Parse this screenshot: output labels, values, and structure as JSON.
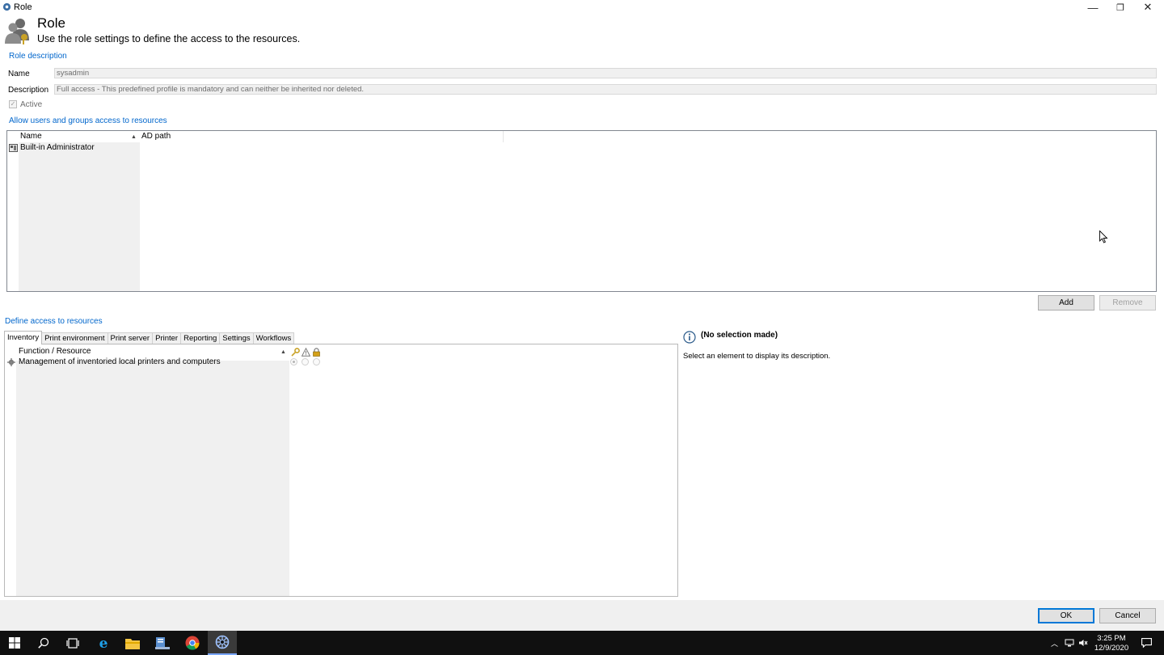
{
  "window": {
    "title": "Role",
    "minimize_glyph": "—",
    "restore_glyph": "❐",
    "close_glyph": "✕"
  },
  "header": {
    "title": "Role",
    "subtitle": "Use the role settings to define the access to the resources."
  },
  "role_description": {
    "group_label": "Role description",
    "name_label": "Name",
    "name_value": "sysadmin",
    "description_label": "Description",
    "description_value": "Full access - This predefined profile is mandatory and can neither be inherited nor deleted.",
    "active_label": "Active",
    "active_checked": true
  },
  "users_groups": {
    "group_label": "Allow users and groups access to resources",
    "columns": [
      "Name",
      "AD path"
    ],
    "rows": [
      {
        "name": "Built-in Administrator",
        "ad_path": ""
      }
    ],
    "add_label": "Add",
    "remove_label": "Remove"
  },
  "resources": {
    "group_label": "Define access to resources",
    "tabs": [
      "Inventory",
      "Print environment",
      "Print server",
      "Printer",
      "Reporting",
      "Settings",
      "Workflows"
    ],
    "active_tab": "Inventory",
    "column_header": "Function / Resource",
    "permission_icons": [
      "key-icon",
      "warning-icon",
      "lock-icon"
    ],
    "rows": [
      {
        "label": "Management of inventoried local printers and computers",
        "selected_permission": 0
      }
    ]
  },
  "description_panel": {
    "title": "(No selection made)",
    "text": "Select an element to display its description."
  },
  "footer": {
    "ok_label": "OK",
    "cancel_label": "Cancel"
  },
  "taskbar": {
    "time": "3:25 PM",
    "date": "12/9/2020",
    "apps": [
      "start-icon",
      "search-icon",
      "task-view-icon",
      "ie-icon",
      "file-explorer-icon",
      "server-manager-icon",
      "chrome-icon",
      "print-app-icon"
    ]
  },
  "colors": {
    "accent": "#0066cc",
    "taskbar": "#101010",
    "dialog_bg": "#f0f0f0"
  }
}
